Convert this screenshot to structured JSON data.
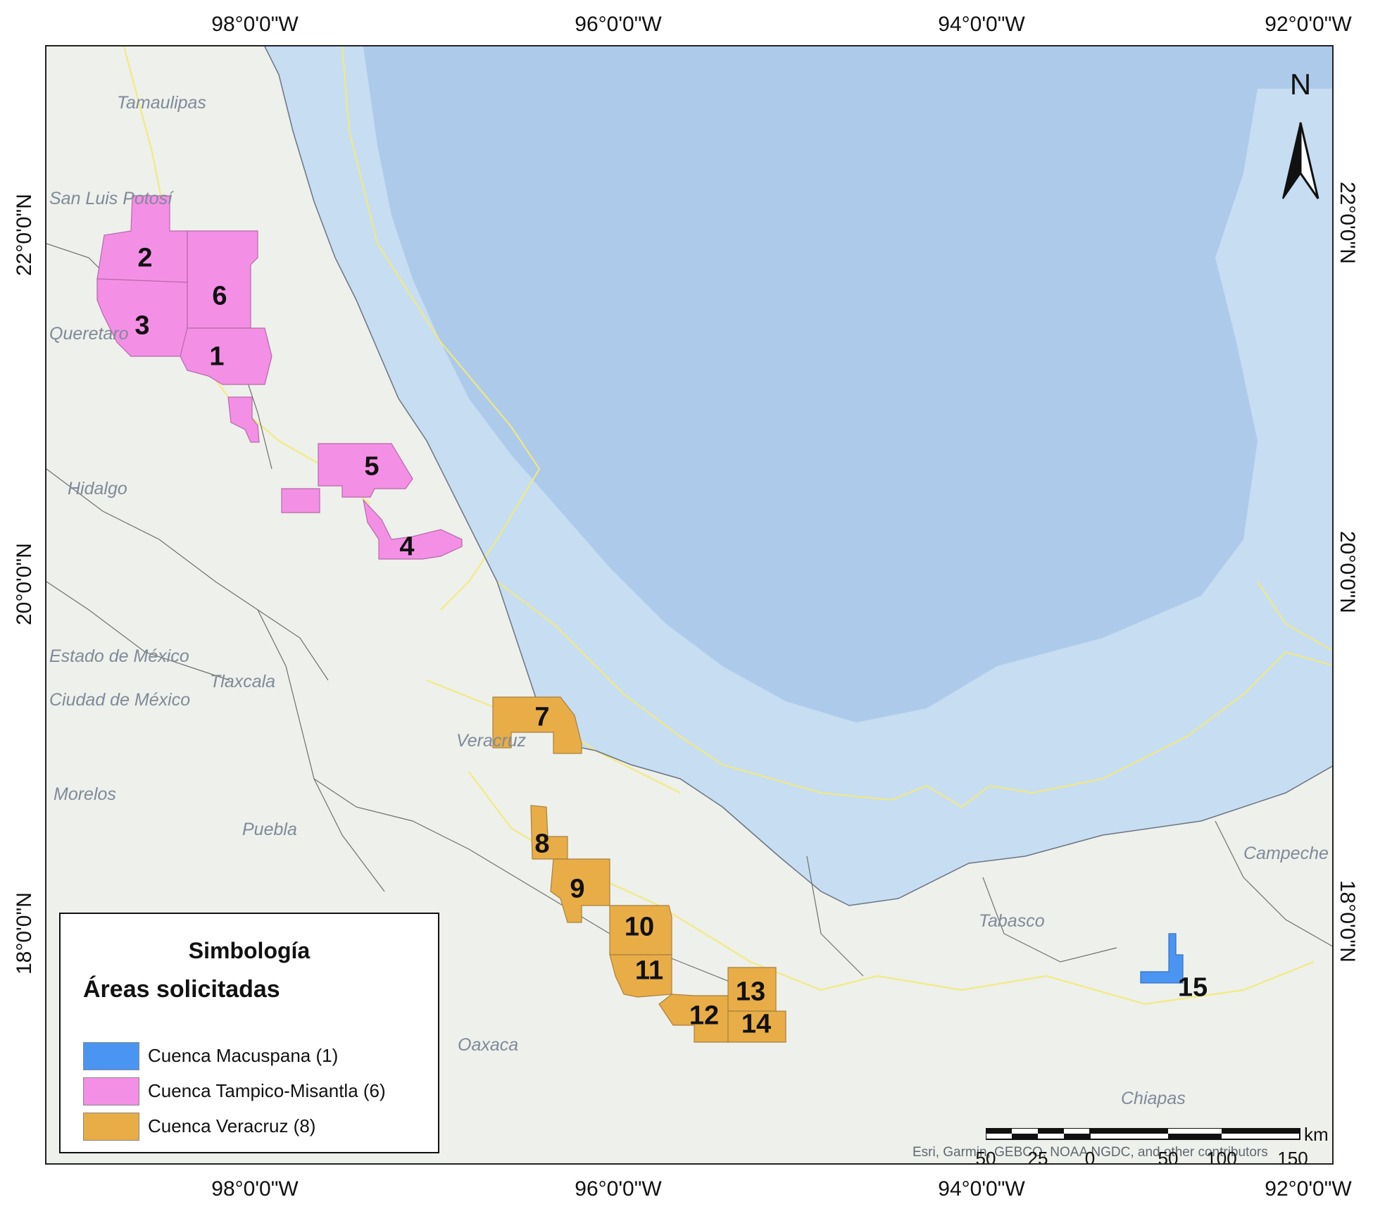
{
  "graticule": {
    "top": [
      "98°0'0\"W",
      "96°0'0\"W",
      "94°0'0\"W",
      "92°0'0\"W"
    ],
    "bottom": [
      "98°0'0\"W",
      "96°0'0\"W",
      "94°0'0\"W",
      "92°0'0\"W"
    ],
    "left": [
      "22°0'0\"N",
      "20°0'0\"N",
      "18°0'0\"N"
    ],
    "right": [
      "22°0'0\"N",
      "20°0'0\"N",
      "18°0'0\"N"
    ]
  },
  "places": {
    "tamaulipas": "Tamaulipas",
    "san_luis_potosi": "San Luis Potosí",
    "queretaro": "Queretaro",
    "hidalgo": "Hidalgo",
    "estado_de_mexico": "Estado de México",
    "tlaxcala": "Tlaxcala",
    "ciudad_de_mexico": "Ciudad de México",
    "veracruz": "Veracruz",
    "morelos": "Morelos",
    "puebla": "Puebla",
    "oaxaca": "Oaxaca",
    "tabasco": "Tabasco",
    "campeche": "Campeche",
    "chiapas": "Chiapas"
  },
  "areas": {
    "a1": "1",
    "a2": "2",
    "a3": "3",
    "a4": "4",
    "a5": "5",
    "a6": "6",
    "a7": "7",
    "a8": "8",
    "a9": "9",
    "a10": "10",
    "a11": "11",
    "a12": "12",
    "a13": "13",
    "a14": "14",
    "a15": "15"
  },
  "north_arrow": {
    "label": "N"
  },
  "legend": {
    "title": "Simbología",
    "subtitle": "Áreas solicitadas",
    "items": [
      {
        "label": "Cuenca Macuspana (1)",
        "color": "#4a95f2"
      },
      {
        "label": "Cuenca Tampico-Misantla (6)",
        "color": "#f48fe6"
      },
      {
        "label": "Cuenca Veracruz (8)",
        "color": "#e8ad46"
      }
    ]
  },
  "scale_bar": {
    "unit": "km",
    "labels": [
      "50",
      "25",
      "0",
      "50",
      "100",
      "150"
    ]
  },
  "attribution": "Esri, Garmin, GEBCO, NOAA NGDC, and other contributors",
  "colors": {
    "land": "#eef0eb",
    "sea": "#c6ddf2",
    "deep_sea": "#aecaea",
    "boundary": "#f2ea7a",
    "tampico_misantla": "#f48fe6",
    "veracruz": "#e8ad46",
    "macuspana": "#4a95f2"
  }
}
